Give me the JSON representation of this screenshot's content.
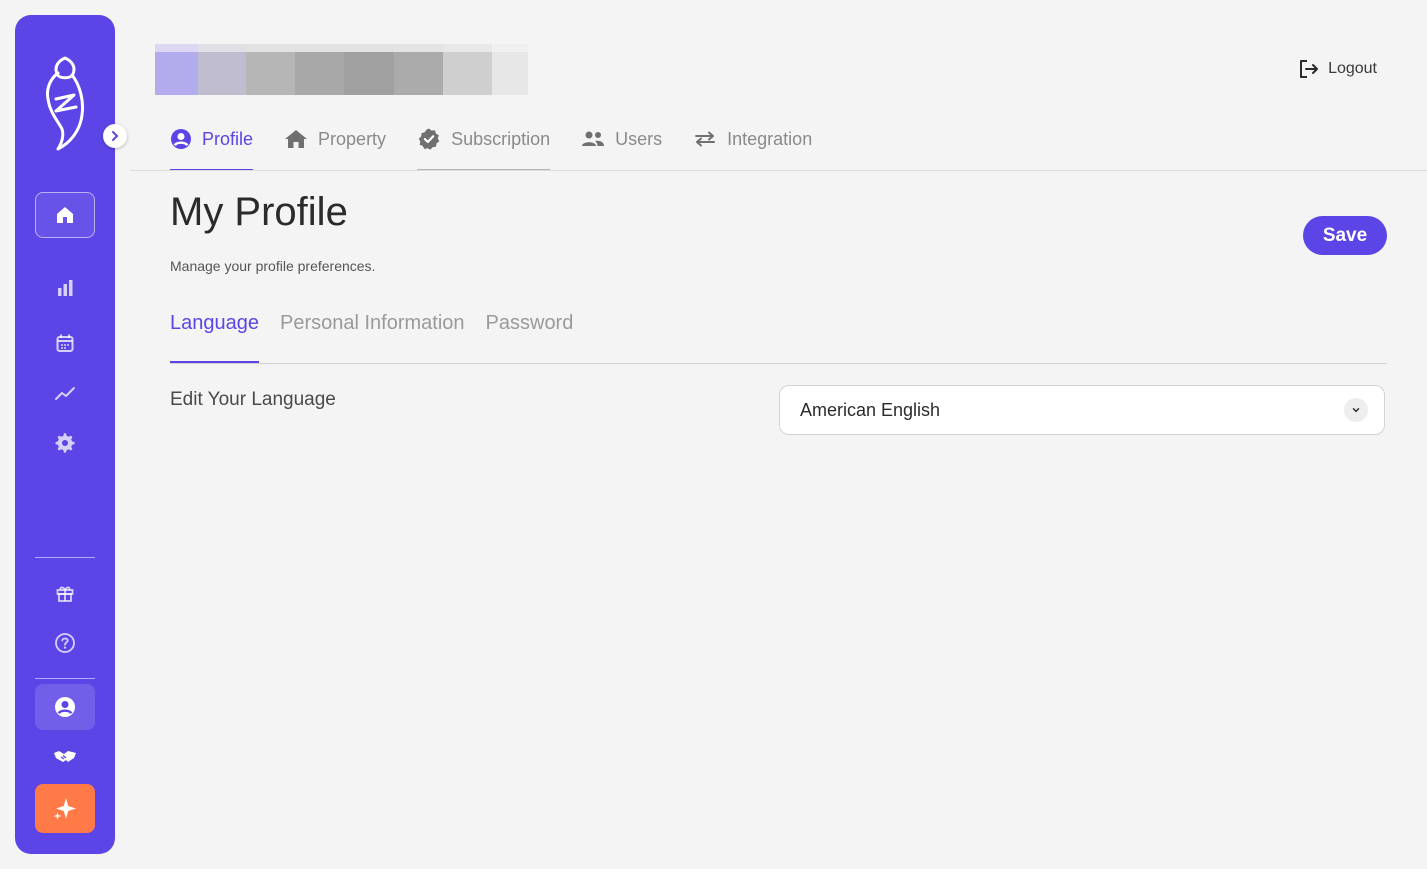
{
  "header": {
    "logout_label": "Logout",
    "tabs": [
      {
        "label": "Profile",
        "icon": "user-circle-icon"
      },
      {
        "label": "Property",
        "icon": "home-icon"
      },
      {
        "label": "Subscription",
        "icon": "badge-check-icon"
      },
      {
        "label": "Users",
        "icon": "users-icon"
      },
      {
        "label": "Integration",
        "icon": "arrows-exchange-icon"
      }
    ],
    "active_tab": "Profile"
  },
  "page": {
    "title": "My Profile",
    "subtitle": "Manage your profile preferences.",
    "save_label": "Save"
  },
  "sub_tabs": [
    {
      "label": "Language"
    },
    {
      "label": "Personal Information"
    },
    {
      "label": "Password"
    }
  ],
  "active_sub_tab": "Language",
  "language": {
    "label": "Edit Your Language",
    "selected": "American English"
  },
  "sidebar": {
    "items": [
      "home-icon",
      "bar-chart-icon",
      "calendar-icon",
      "trend-line-icon",
      "gear-icon",
      "gift-icon",
      "help-icon",
      "profile-icon",
      "handshake-icon",
      "sparkle-icon"
    ]
  },
  "colors": {
    "accent": "#5b45e6",
    "ai_button": "#ff7a47",
    "background": "#f3f4f3"
  }
}
